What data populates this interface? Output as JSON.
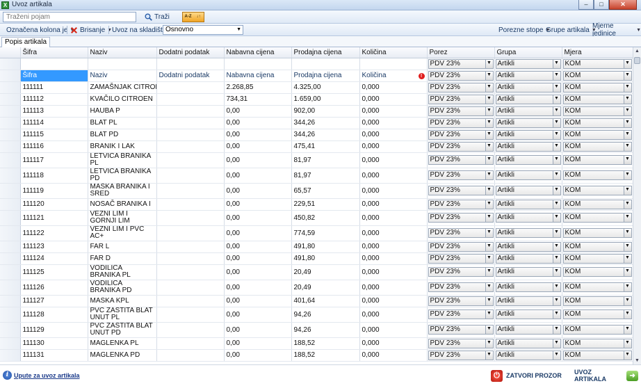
{
  "window": {
    "title": "Uvoz artikala",
    "min": "–",
    "max": "□",
    "close": "✕"
  },
  "toolbar": {
    "search_placeholder": "Traženi pojam",
    "search_label": "Traži",
    "sort_icons": [
      "A-Z",
      "↓↑"
    ],
    "marked_column": "Označena kolona je",
    "delete_label": "Brisanje",
    "warehouse_label": "Uvoz na skladište :",
    "warehouse_value": "Osnovno",
    "tax_rates": "Porezne stope",
    "item_groups": "Grupe artikala",
    "units": "Mjerne jedinice"
  },
  "tab": {
    "label": "Popis artikala"
  },
  "columns": [
    "Šifra",
    "Naziv",
    "Dodatni podatak",
    "Nabavna cijena",
    "Prodajna cijena",
    "Količina",
    "Porez",
    "Grupa",
    "Mjera"
  ],
  "filter_row": {
    "porez": "PDV 23%",
    "grupa": "Artikli",
    "mjera": "KOM"
  },
  "edit_row": {
    "sifra": "Šifra",
    "naziv": "Naziv",
    "dodatni": "Dodatni podatak",
    "nabavna": "Nabavna cijena",
    "prodajna": "Prodajna cijena",
    "kolicina": "Količina",
    "err": "!",
    "porez": "PDV 23%",
    "grupa": "Artikli",
    "mjera": "KOM"
  },
  "rows": [
    {
      "sifra": "111111",
      "naziv": "ZAMAŠNJAK CITROEN",
      "dodatni": "",
      "nabavna": "2.268,85",
      "prodajna": "4.325,00",
      "kolicina": "0,000",
      "porez": "PDV 23%",
      "grupa": "Artikli",
      "mjera": "KOM"
    },
    {
      "sifra": "111112",
      "naziv": "KVAČILO CITROEN",
      "dodatni": "",
      "nabavna": "734,31",
      "prodajna": "1.659,00",
      "kolicina": "0,000",
      "porez": "PDV 23%",
      "grupa": "Artikli",
      "mjera": "KOM"
    },
    {
      "sifra": "111113",
      "naziv": "HAUBA P",
      "dodatni": "",
      "nabavna": "0,00",
      "prodajna": "902,00",
      "kolicina": "0,000",
      "porez": "PDV 23%",
      "grupa": "Artikli",
      "mjera": "KOM"
    },
    {
      "sifra": "111114",
      "naziv": "BLAT PL",
      "dodatni": "",
      "nabavna": "0,00",
      "prodajna": "344,26",
      "kolicina": "0,000",
      "porez": "PDV 23%",
      "grupa": "Artikli",
      "mjera": "KOM"
    },
    {
      "sifra": "111115",
      "naziv": "BLAT PD",
      "dodatni": "",
      "nabavna": "0,00",
      "prodajna": "344,26",
      "kolicina": "0,000",
      "porez": "PDV 23%",
      "grupa": "Artikli",
      "mjera": "KOM"
    },
    {
      "sifra": "111116",
      "naziv": "BRANIK I LAK",
      "dodatni": "",
      "nabavna": "0,00",
      "prodajna": "475,41",
      "kolicina": "0,000",
      "porez": "PDV 23%",
      "grupa": "Artikli",
      "mjera": "KOM"
    },
    {
      "sifra": "111117",
      "naziv": "LETVICA BRANIKA PL",
      "dodatni": "",
      "nabavna": "0,00",
      "prodajna": "81,97",
      "kolicina": "0,000",
      "porez": "PDV 23%",
      "grupa": "Artikli",
      "mjera": "KOM"
    },
    {
      "sifra": "111118",
      "naziv": "LETVICA BRANIKA PD",
      "dodatni": "",
      "nabavna": "0,00",
      "prodajna": "81,97",
      "kolicina": "0,000",
      "porez": "PDV 23%",
      "grupa": "Artikli",
      "mjera": "KOM"
    },
    {
      "sifra": "111119",
      "naziv": "MASKA BRANIKA I SRED",
      "dodatni": "",
      "nabavna": "0,00",
      "prodajna": "65,57",
      "kolicina": "0,000",
      "porez": "PDV 23%",
      "grupa": "Artikli",
      "mjera": "KOM"
    },
    {
      "sifra": "111120",
      "naziv": "NOSAČ BRANIKA I",
      "dodatni": "",
      "nabavna": "0,00",
      "prodajna": "229,51",
      "kolicina": "0,000",
      "porez": "PDV 23%",
      "grupa": "Artikli",
      "mjera": "KOM"
    },
    {
      "sifra": "111121",
      "naziv": "VEZNI LIM I GORNJI LIM",
      "dodatni": "",
      "nabavna": "0,00",
      "prodajna": "450,82",
      "kolicina": "0,000",
      "porez": "PDV 23%",
      "grupa": "Artikli",
      "mjera": "KOM"
    },
    {
      "sifra": "111122",
      "naziv": "VEZNI LIM I PVC AC+",
      "dodatni": "",
      "nabavna": "0,00",
      "prodajna": "774,59",
      "kolicina": "0,000",
      "porez": "PDV 23%",
      "grupa": "Artikli",
      "mjera": "KOM"
    },
    {
      "sifra": "111123",
      "naziv": "FAR L",
      "dodatni": "",
      "nabavna": "0,00",
      "prodajna": "491,80",
      "kolicina": "0,000",
      "porez": "PDV 23%",
      "grupa": "Artikli",
      "mjera": "KOM"
    },
    {
      "sifra": "111124",
      "naziv": "FAR D",
      "dodatni": "",
      "nabavna": "0,00",
      "prodajna": "491,80",
      "kolicina": "0,000",
      "porez": "PDV 23%",
      "grupa": "Artikli",
      "mjera": "KOM"
    },
    {
      "sifra": "111125",
      "naziv": "VODILICA BRANIKA PL",
      "dodatni": "",
      "nabavna": "0,00",
      "prodajna": "20,49",
      "kolicina": "0,000",
      "porez": "PDV 23%",
      "grupa": "Artikli",
      "mjera": "KOM"
    },
    {
      "sifra": "111126",
      "naziv": "VODILICA BRANIKA PD",
      "dodatni": "",
      "nabavna": "0,00",
      "prodajna": "20,49",
      "kolicina": "0,000",
      "porez": "PDV 23%",
      "grupa": "Artikli",
      "mjera": "KOM"
    },
    {
      "sifra": "111127",
      "naziv": "MASKA KPL",
      "dodatni": "",
      "nabavna": "0,00",
      "prodajna": "401,64",
      "kolicina": "0,000",
      "porez": "PDV 23%",
      "grupa": "Artikli",
      "mjera": "KOM"
    },
    {
      "sifra": "111128",
      "naziv": "PVC ZAŠTITA BLAT UNUT PL",
      "dodatni": "",
      "nabavna": "0,00",
      "prodajna": "94,26",
      "kolicina": "0,000",
      "porez": "PDV 23%",
      "grupa": "Artikli",
      "mjera": "KOM"
    },
    {
      "sifra": "111129",
      "naziv": "PVC ZAŠTITA BLAT UNUT PD",
      "dodatni": "",
      "nabavna": "0,00",
      "prodajna": "94,26",
      "kolicina": "0,000",
      "porez": "PDV 23%",
      "grupa": "Artikli",
      "mjera": "KOM"
    },
    {
      "sifra": "111130",
      "naziv": "MAGLENKA PL",
      "dodatni": "",
      "nabavna": "0,00",
      "prodajna": "188,52",
      "kolicina": "0,000",
      "porez": "PDV 23%",
      "grupa": "Artikli",
      "mjera": "KOM"
    },
    {
      "sifra": "111131",
      "naziv": "MAGLENKA PD",
      "dodatni": "",
      "nabavna": "0,00",
      "prodajna": "188,52",
      "kolicina": "0,000",
      "porez": "PDV 23%",
      "grupa": "Artikli",
      "mjera": "KOM"
    }
  ],
  "footer": {
    "help_link": "Upute za uvoz artikala",
    "close_label": "ZATVORI PROZOR",
    "import_label": "UVOZ ARTIKALA"
  }
}
